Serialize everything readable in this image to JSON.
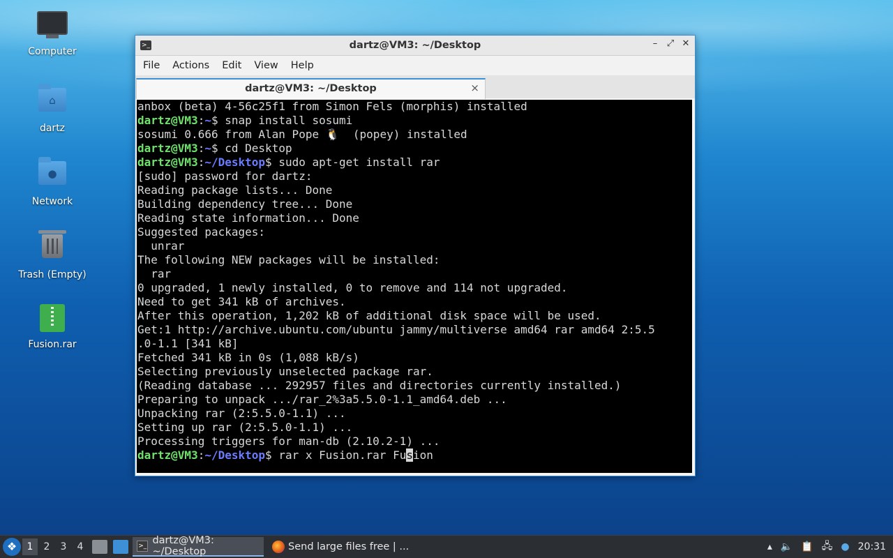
{
  "desktop": {
    "icons": [
      {
        "label": "Computer"
      },
      {
        "label": "dartz"
      },
      {
        "label": "Network"
      },
      {
        "label": "Trash (Empty)"
      },
      {
        "label": "Fusion.rar"
      }
    ]
  },
  "window": {
    "title": "dartz@VM3: ~/Desktop",
    "menu": [
      "File",
      "Actions",
      "Edit",
      "View",
      "Help"
    ],
    "tab_label": "dartz@VM3: ~/Desktop",
    "tab_close": "×",
    "controls": {
      "minimize": "–",
      "maximize": "⤢",
      "close": "✕"
    }
  },
  "terminal": {
    "prompt_user": "dartz@VM3",
    "lines": [
      {
        "text": "anbox (beta) 4-56c25f1 from Simon Fels (morphis) installed"
      },
      {
        "user": "dartz@VM3",
        "sep": ":",
        "path": "~",
        "cmd": "$ snap install sosumi"
      },
      {
        "text": "sosumi 0.666 from Alan Pope 🐧  (popey) installed"
      },
      {
        "user": "dartz@VM3",
        "sep": ":",
        "path": "~",
        "cmd": "$ cd Desktop"
      },
      {
        "user": "dartz@VM3",
        "sep": ":",
        "path": "~/Desktop",
        "cmd": "$ sudo apt-get install rar"
      },
      {
        "text": "[sudo] password for dartz:"
      },
      {
        "text": "Reading package lists... Done"
      },
      {
        "text": "Building dependency tree... Done"
      },
      {
        "text": "Reading state information... Done"
      },
      {
        "text": "Suggested packages:"
      },
      {
        "text": "  unrar"
      },
      {
        "text": "The following NEW packages will be installed:"
      },
      {
        "text": "  rar"
      },
      {
        "text": "0 upgraded, 1 newly installed, 0 to remove and 114 not upgraded."
      },
      {
        "text": "Need to get 341 kB of archives."
      },
      {
        "text": "After this operation, 1,202 kB of additional disk space will be used."
      },
      {
        "text": "Get:1 http://archive.ubuntu.com/ubuntu jammy/multiverse amd64 rar amd64 2:5.5"
      },
      {
        "text": ".0-1.1 [341 kB]"
      },
      {
        "text": "Fetched 341 kB in 0s (1,088 kB/s)"
      },
      {
        "text": "Selecting previously unselected package rar."
      },
      {
        "text": "(Reading database ... 292957 files and directories currently installed.)"
      },
      {
        "text": "Preparing to unpack .../rar_2%3a5.5.0-1.1_amd64.deb ..."
      },
      {
        "text": "Unpacking rar (2:5.5.0-1.1) ..."
      },
      {
        "text": "Setting up rar (2:5.5.0-1.1) ..."
      },
      {
        "text": "Processing triggers for man-db (2.10.2-1) ..."
      }
    ],
    "current": {
      "user": "dartz@VM3",
      "sep": ":",
      "path": "~/Desktop",
      "before_cursor": "$ rar x Fusion.rar Fu",
      "cursor_char": "s",
      "after_cursor": "ion"
    }
  },
  "taskbar": {
    "workspaces": [
      "1",
      "2",
      "3",
      "4"
    ],
    "tasks": [
      {
        "label": "dartz@VM3: ~/Desktop"
      },
      {
        "label": "Send large files free | ..."
      }
    ],
    "clock": "20:31"
  }
}
